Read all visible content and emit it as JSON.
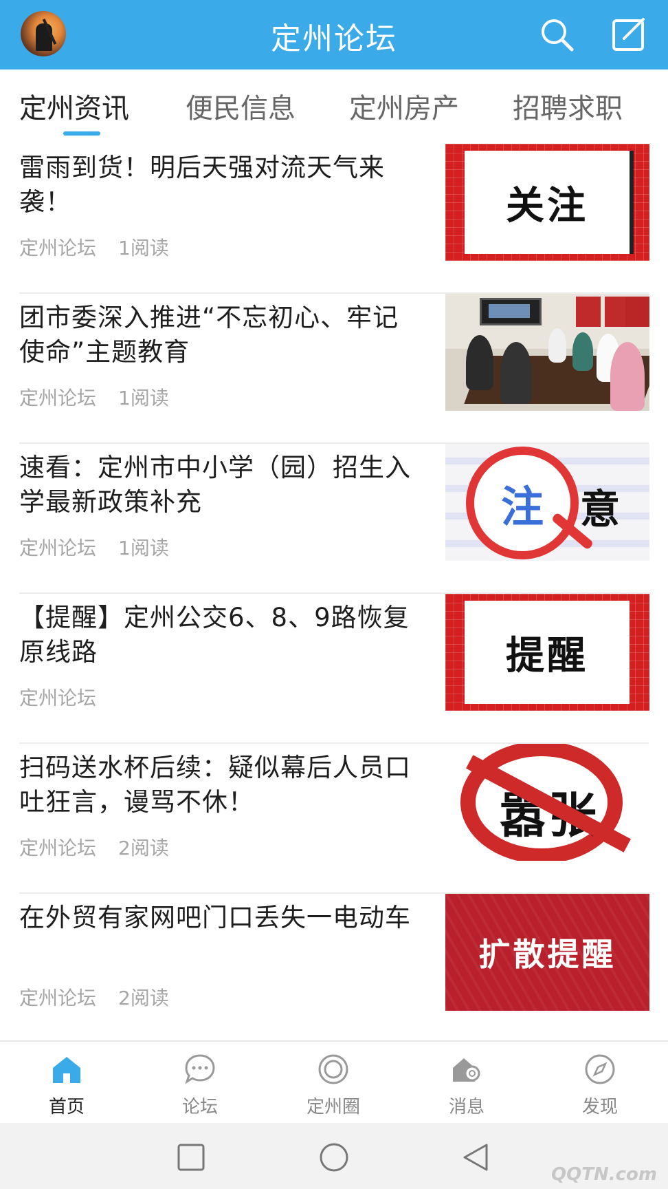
{
  "header": {
    "title": "定州论坛",
    "avatar_icon": "avatar-icon",
    "search_icon": "search-icon",
    "edit_icon": "edit-icon",
    "bar_color": "#3aaae8"
  },
  "tabs": [
    {
      "label": "定州资讯",
      "active": true
    },
    {
      "label": "便民信息",
      "active": false
    },
    {
      "label": "定州房产",
      "active": false
    },
    {
      "label": "招聘求职",
      "active": false
    }
  ],
  "news": [
    {
      "title": "雷雨到货！明后天强对流天气来袭！",
      "source": "定州论坛",
      "reads": "1阅读",
      "thumb_text": "关注"
    },
    {
      "title": "团市委深入推进“不忘初心、牢记使命”主题教育",
      "source": "定州论坛",
      "reads": "1阅读",
      "thumb_text": ""
    },
    {
      "title": "速看：定州市中小学（园）招生入学最新政策补充",
      "source": "定州论坛",
      "reads": "1阅读",
      "thumb_text": "注",
      "thumb_text2": "意"
    },
    {
      "title": "【提醒】定州公交6、8、9路恢复原线路",
      "source": "定州论坛",
      "reads": "",
      "thumb_text": "提醒"
    },
    {
      "title": "扫码送水杯后续：疑似幕后人员口吐狂言，谩骂不休！",
      "source": "定州论坛",
      "reads": "2阅读",
      "thumb_text": "嚣张"
    },
    {
      "title": "在外贸有家网吧门口丢失一电动车",
      "source": "定州论坛",
      "reads": "2阅读",
      "thumb_text": "扩散提醒"
    }
  ],
  "bottom_nav": [
    {
      "label": "首页",
      "icon": "home-icon",
      "active": true
    },
    {
      "label": "论坛",
      "icon": "chat-bubble-icon",
      "active": false
    },
    {
      "label": "定州圈",
      "icon": "circle-icon",
      "active": false
    },
    {
      "label": "消息",
      "icon": "message-house-icon",
      "active": false
    },
    {
      "label": "发现",
      "icon": "compass-icon",
      "active": false
    }
  ],
  "system_bar": {
    "buttons": [
      "recent-apps-icon",
      "home-circle-icon",
      "back-triangle-icon"
    ],
    "watermark": "QQTN.com"
  }
}
